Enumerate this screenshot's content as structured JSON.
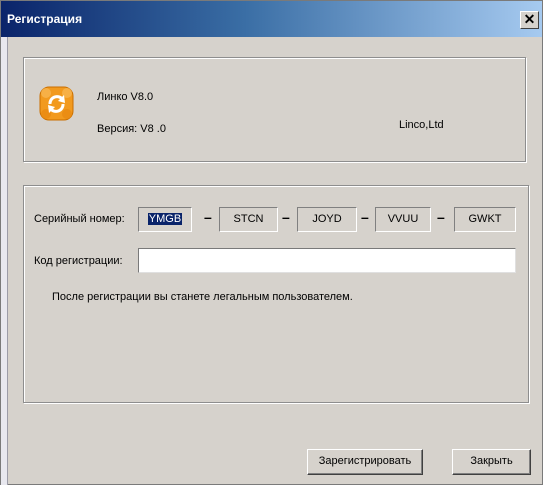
{
  "window": {
    "title": "Регистрация",
    "close_glyph": "✕"
  },
  "product": {
    "icon": "refresh-icon",
    "name": "Линко V8.0",
    "version": "Версия: V8 .0",
    "company": "Linco,Ltd"
  },
  "registration": {
    "serial_label": "Серийный номер:",
    "serial_parts": [
      "YMGB",
      "STCN",
      "JOYD",
      "VVUU",
      "GWKT"
    ],
    "separator": "–",
    "code_label": "Код регистрации:",
    "code_value": "",
    "note": "После регистрации вы станете легальным пользователем."
  },
  "buttons": {
    "register": "Зарегистрировать",
    "close": "Закрыть"
  },
  "colors": {
    "title_gradient_start": "#0a246a",
    "title_gradient_end": "#a6caf0",
    "window_bg": "#d6d2cc",
    "icon_orange": "#f29a1e",
    "selection": "#0a246a"
  }
}
